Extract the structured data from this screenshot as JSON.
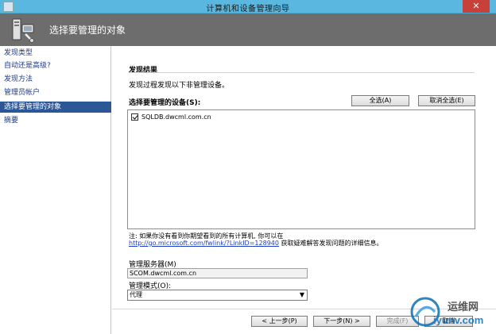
{
  "window": {
    "title": "计算机和设备管理向导",
    "close_glyph": "✕"
  },
  "header": {
    "title": "选择要管理的对象",
    "icon": "wizard-computer-icon"
  },
  "nav": {
    "items": [
      {
        "label": "发现类型"
      },
      {
        "label": "自动还是高级?"
      },
      {
        "label": "发现方法"
      },
      {
        "label": "管理员帐户"
      },
      {
        "label": "选择要管理的对象"
      },
      {
        "label": "摘要"
      }
    ],
    "active_index": 4
  },
  "main": {
    "section_title": "发现结果",
    "description": "发现过程发现以下非管理设备。",
    "list_label": "选择要管理的设备(S):",
    "select_all_label": "全选(A)",
    "deselect_all_label": "取消全选(E)",
    "devices": [
      {
        "name": "SQLDB.dwcml.com.cn",
        "checked": true
      }
    ],
    "note_line1": "注: 如果你没有看到你期望看到的所有计算机, 你可以在",
    "note_link": "http://go.microsoft.com/fwlink/?LinkID=128940",
    "note_line2_suffix": " 获取疑难解答发现问题的详细信息。",
    "server_label": "管理服务器(M)",
    "server_value": "SCOM.dwcml.com.cn",
    "mode_label": "管理模式(O):",
    "mode_value": "代理"
  },
  "footer": {
    "prev_label": "< 上一步(P)",
    "next_label": "下一步(N) >",
    "finish_label": "完成(F)",
    "cancel_label": "取消"
  },
  "watermark": {
    "line1": "运维网",
    "line2": "iyunv.com"
  },
  "colors": {
    "titlebar": "#5ab8e0",
    "header": "#6d6d6d",
    "nav_active": "#2b5797",
    "nav_text": "#1d3a8a",
    "link": "#1e3fbf",
    "close": "#c7403a"
  }
}
